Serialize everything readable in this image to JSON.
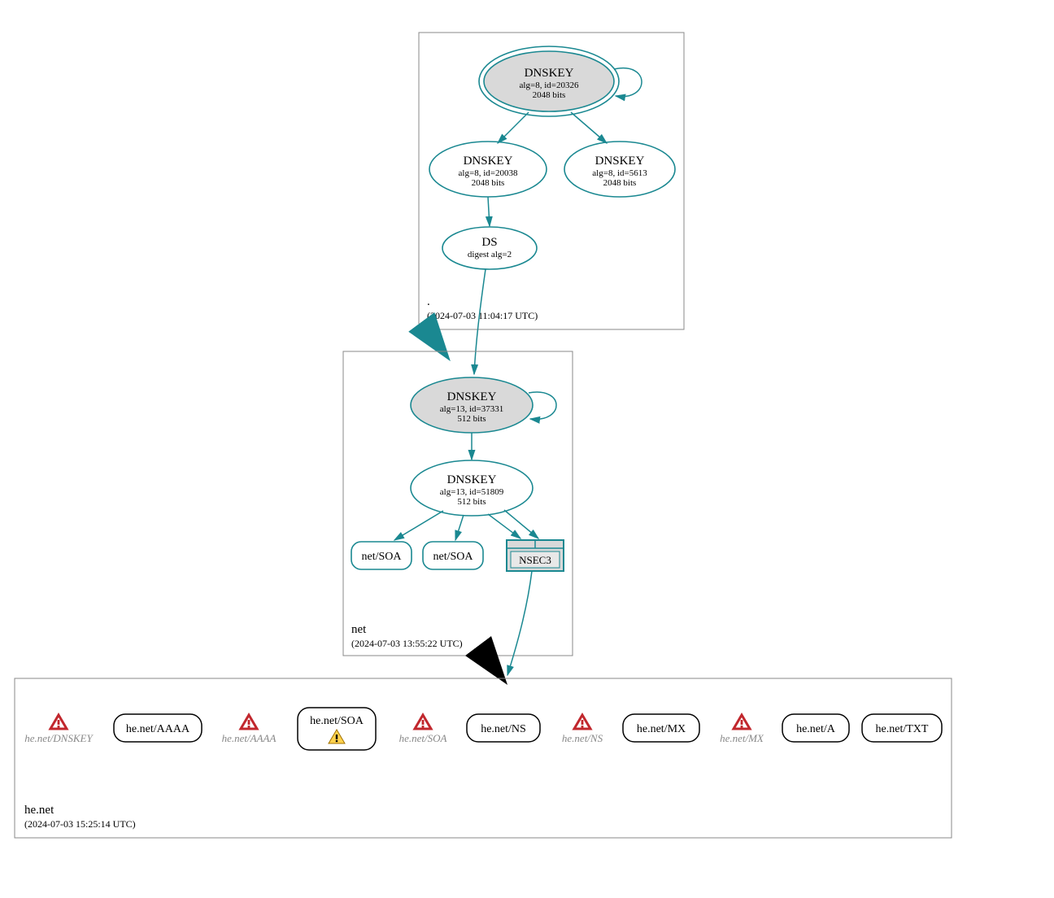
{
  "colors": {
    "teal": "#1a8891",
    "grey_fill": "#d9d9d9",
    "warn_red": "#c1272d",
    "warn_yellow": "#ffcc33"
  },
  "zones": {
    "root": {
      "label": ".",
      "timestamp": "(2024-07-03 11:04:17 UTC)"
    },
    "net": {
      "label": "net",
      "timestamp": "(2024-07-03 13:55:22 UTC)"
    },
    "henet": {
      "label": "he.net",
      "timestamp": "(2024-07-03 15:25:14 UTC)"
    }
  },
  "root_keys": {
    "ksk": {
      "title": "DNSKEY",
      "line1": "alg=8, id=20326",
      "line2": "2048 bits"
    },
    "zsk1": {
      "title": "DNSKEY",
      "line1": "alg=8, id=20038",
      "line2": "2048 bits"
    },
    "zsk2": {
      "title": "DNSKEY",
      "line1": "alg=8, id=5613",
      "line2": "2048 bits"
    },
    "ds": {
      "title": "DS",
      "line1": "digest alg=2"
    }
  },
  "net_keys": {
    "ksk": {
      "title": "DNSKEY",
      "line1": "alg=13, id=37331",
      "line2": "512 bits"
    },
    "zsk": {
      "title": "DNSKEY",
      "line1": "alg=13, id=51809",
      "line2": "512 bits"
    },
    "soa1": "net/SOA",
    "soa2": "net/SOA",
    "nsec3": "NSEC3"
  },
  "henet_nodes": {
    "warn_dnskey": "he.net/DNSKEY",
    "aaaa": "he.net/AAAA",
    "warn_aaaa": "he.net/AAAA",
    "soa": "he.net/SOA",
    "warn_soa": "he.net/SOA",
    "ns": "he.net/NS",
    "warn_ns": "he.net/NS",
    "mx": "he.net/MX",
    "warn_mx": "he.net/MX",
    "a": "he.net/A",
    "txt": "he.net/TXT"
  }
}
